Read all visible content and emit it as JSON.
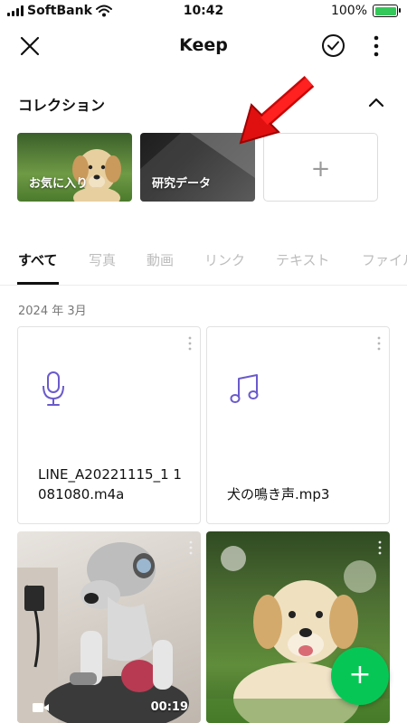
{
  "status_bar": {
    "carrier": "SoftBank",
    "time": "10:42",
    "battery": "100%"
  },
  "header": {
    "title": "Keep",
    "icons": [
      "close-icon",
      "check-circle-icon",
      "more-vertical-icon"
    ]
  },
  "collection": {
    "title": "コレクション",
    "items": [
      {
        "label": "お気に入り"
      },
      {
        "label": "研究データ"
      }
    ],
    "add_label": "+"
  },
  "tabs": [
    {
      "label": "すべて",
      "active": true
    },
    {
      "label": "写真",
      "active": false
    },
    {
      "label": "動画",
      "active": false
    },
    {
      "label": "リンク",
      "active": false
    },
    {
      "label": "テキスト",
      "active": false
    },
    {
      "label": "ファイル",
      "active": false
    }
  ],
  "date_label": "2024 年 3月",
  "items": [
    {
      "type": "audio",
      "icon": "microphone-icon",
      "name": "LINE_A20221115_1 1081080.m4a"
    },
    {
      "type": "audio",
      "icon": "music-note-icon",
      "name": "犬の鳴き声.mp3"
    },
    {
      "type": "video",
      "duration": "00:19"
    },
    {
      "type": "photo"
    }
  ],
  "fab_label": "+",
  "colors": {
    "accent_green": "#06c755",
    "icon_purple": "#6a5acd",
    "annotation_red": "#e01010"
  }
}
